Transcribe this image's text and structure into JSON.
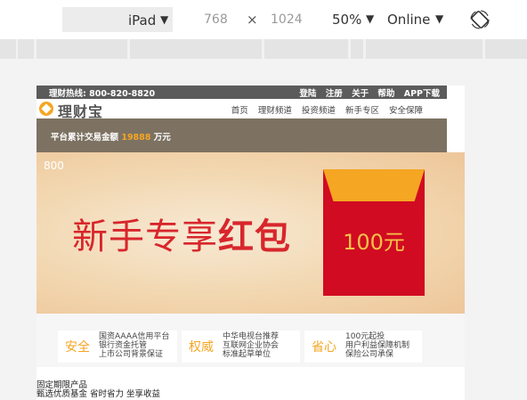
{
  "devtools": {
    "device": "iPad",
    "width": "768",
    "times": "×",
    "height": "1024",
    "zoom": "50%",
    "network": "Online",
    "rotate_icon": "rotate-icon"
  },
  "site": {
    "topbar": {
      "hotline": "理财热线: 800-820-8820",
      "links": [
        "登陆",
        "注册",
        "关于",
        "帮助",
        "APP下载"
      ]
    },
    "logo": {
      "text": "理财宝",
      "icon": "logo-icon",
      "color": "#f5a623"
    },
    "nav": [
      "首页",
      "理财频道",
      "投资频道",
      "新手专区",
      "安全保障"
    ],
    "stats": {
      "prefix": "平台累计交易金额",
      "amount": "19888",
      "unit": "万元"
    },
    "banner": {
      "number": "800",
      "headline_light": "新手专享",
      "headline_bold": "红包",
      "envelope_amount": "100元",
      "accent": "#d8262c"
    },
    "features": [
      {
        "label": "安全",
        "lines": [
          "国资AAAA信用平台",
          "银行资金托管",
          "上市公司背景保证"
        ]
      },
      {
        "label": "权威",
        "lines": [
          "中华电视台推荐",
          "互联网企业协会",
          "标准起草单位"
        ]
      },
      {
        "label": "省心",
        "lines": [
          "100元起投",
          "用户利益保障机制",
          "保险公司承保"
        ]
      }
    ],
    "product": {
      "title": "固定期限产品",
      "subtitle": "甄选优质基金 省时省力 坐享收益"
    }
  }
}
